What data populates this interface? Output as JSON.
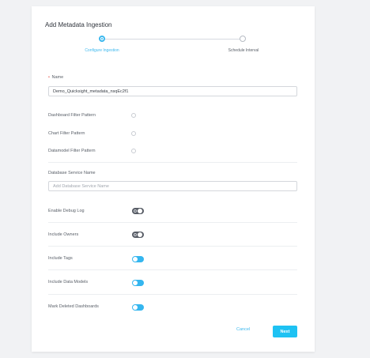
{
  "dialog": {
    "title": "Add Metadata Ingestion"
  },
  "stepper": {
    "steps": [
      {
        "label": "Configure Ingestion",
        "state": "active"
      },
      {
        "label": "Schedule Interval",
        "state": "inactive"
      }
    ]
  },
  "form": {
    "name": {
      "label": "Name",
      "required": true,
      "value": "Demo_Quicksight_metadata_nsqEc2f1"
    },
    "filter_patterns": [
      {
        "label": "Dashboard Filter Pattern",
        "checked": false
      },
      {
        "label": "Chart Filter Pattern",
        "checked": false
      },
      {
        "label": "Datamodel Filter Pattern",
        "checked": false
      }
    ],
    "database_service": {
      "label": "Database Service Name",
      "placeholder": "Add Database Service Name",
      "value": ""
    },
    "toggles": [
      {
        "label": "Enable Debug Log",
        "enabled": false
      },
      {
        "label": "Include Owners",
        "enabled": false
      },
      {
        "label": "Include Tags",
        "enabled": true
      },
      {
        "label": "Include Data Models",
        "enabled": true
      },
      {
        "label": "Mark Deleted Dashboards",
        "enabled": true
      }
    ]
  },
  "actions": {
    "cancel_label": "Cancel",
    "next_label": "Next"
  },
  "colors": {
    "accent": "#3cb8ee",
    "primary_button": "#1ec2f3",
    "toggle_off": "#585d66",
    "required": "#e5544b"
  }
}
